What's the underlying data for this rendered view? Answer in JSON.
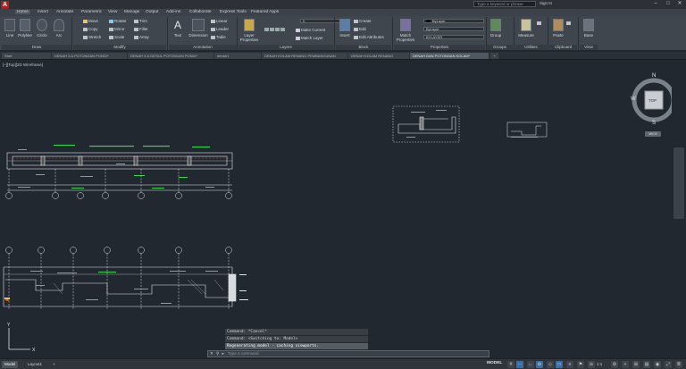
{
  "title_bar": {
    "app_letter": "A",
    "search_placeholder": "Type a keyword or phrase",
    "sign_in": "Sign In"
  },
  "menu": {
    "tabs": [
      "Home",
      "Insert",
      "Annotate",
      "Parametric",
      "View",
      "Manage",
      "Output",
      "Add-ins",
      "Collaborate",
      "Express Tools",
      "Featured Apps"
    ],
    "active": "Home"
  },
  "ribbon": {
    "draw": {
      "line": "Line",
      "polyline": "Polyline",
      "circle": "Circle",
      "arc": "Arc",
      "label": "Draw"
    },
    "modify": {
      "move": "Move",
      "rotate": "Rotate",
      "trim": "Trim",
      "copy": "Copy",
      "mirror": "Mirror",
      "fillet": "Fillet",
      "stretch": "Stretch",
      "scale": "Scale",
      "array": "Array",
      "label": "Modify"
    },
    "annotation": {
      "text": "Text",
      "dimension": "Dimension",
      "linear": "Linear",
      "leader": "Leader",
      "table": "Table",
      "label": "Annotation"
    },
    "layers": {
      "properties": "Layer Properties",
      "make_current": "Make Current",
      "match_layer": "Match Layer",
      "current_layer": "0",
      "label": "Layers"
    },
    "block": {
      "insert": "Insert",
      "create": "Create",
      "edit": "Edit",
      "edit_attributes": "Edit Attributes",
      "label": "Block"
    },
    "properties": {
      "match": "Match Properties",
      "color": "ByLayer",
      "linetype": "ByLayer",
      "lineweight": "BYLAYER",
      "label": "Properties"
    },
    "groups": {
      "group": "Group",
      "label": "Groups"
    },
    "utilities": {
      "measure": "Measure",
      "label": "Utilities"
    },
    "clipboard": {
      "paste": "Paste",
      "label": "Clipboard"
    },
    "view": {
      "base": "Base",
      "label": "View"
    }
  },
  "file_tabs": [
    {
      "label": "Start",
      "active": false
    },
    {
      "label": "DENAH 3 & POTONGAN PONDI*",
      "active": false
    },
    {
      "label": "DENAH 3 & DETAIL POTONGAN PONDI*",
      "active": false
    },
    {
      "label": "denah1",
      "active": false
    },
    {
      "label": "DENAH KOLAM RENANG PEMBANGUNAN",
      "active": false
    },
    {
      "label": "DENAH KOLAM RENANG",
      "active": false
    },
    {
      "label": "DENAH DAN POTONGAN KOLAM*",
      "active": true
    }
  ],
  "viewport": {
    "label": "[–][Top][2D Wireframe]"
  },
  "viewcube": {
    "n": "N",
    "s": "S",
    "e": "E",
    "w": "W",
    "face": "TOP",
    "wcs": "WCS"
  },
  "command_history": [
    "Command: *Cancel*",
    "Command: <Switching to: Model>",
    "Regenerating model - caching viewports."
  ],
  "command_placeholder": "Type a command",
  "layout_tabs": [
    {
      "label": "Model",
      "active": true
    },
    {
      "label": "Layout1",
      "active": false
    }
  ],
  "status": {
    "mode": "MODEL",
    "scale": "1:1"
  },
  "colors": {
    "accent": "#3a6ea5",
    "drawing_bg": "#212830",
    "drawing_green": "#39d64c",
    "drawing_white": "#e0e4e8",
    "drawing_red": "#e84a3a"
  }
}
